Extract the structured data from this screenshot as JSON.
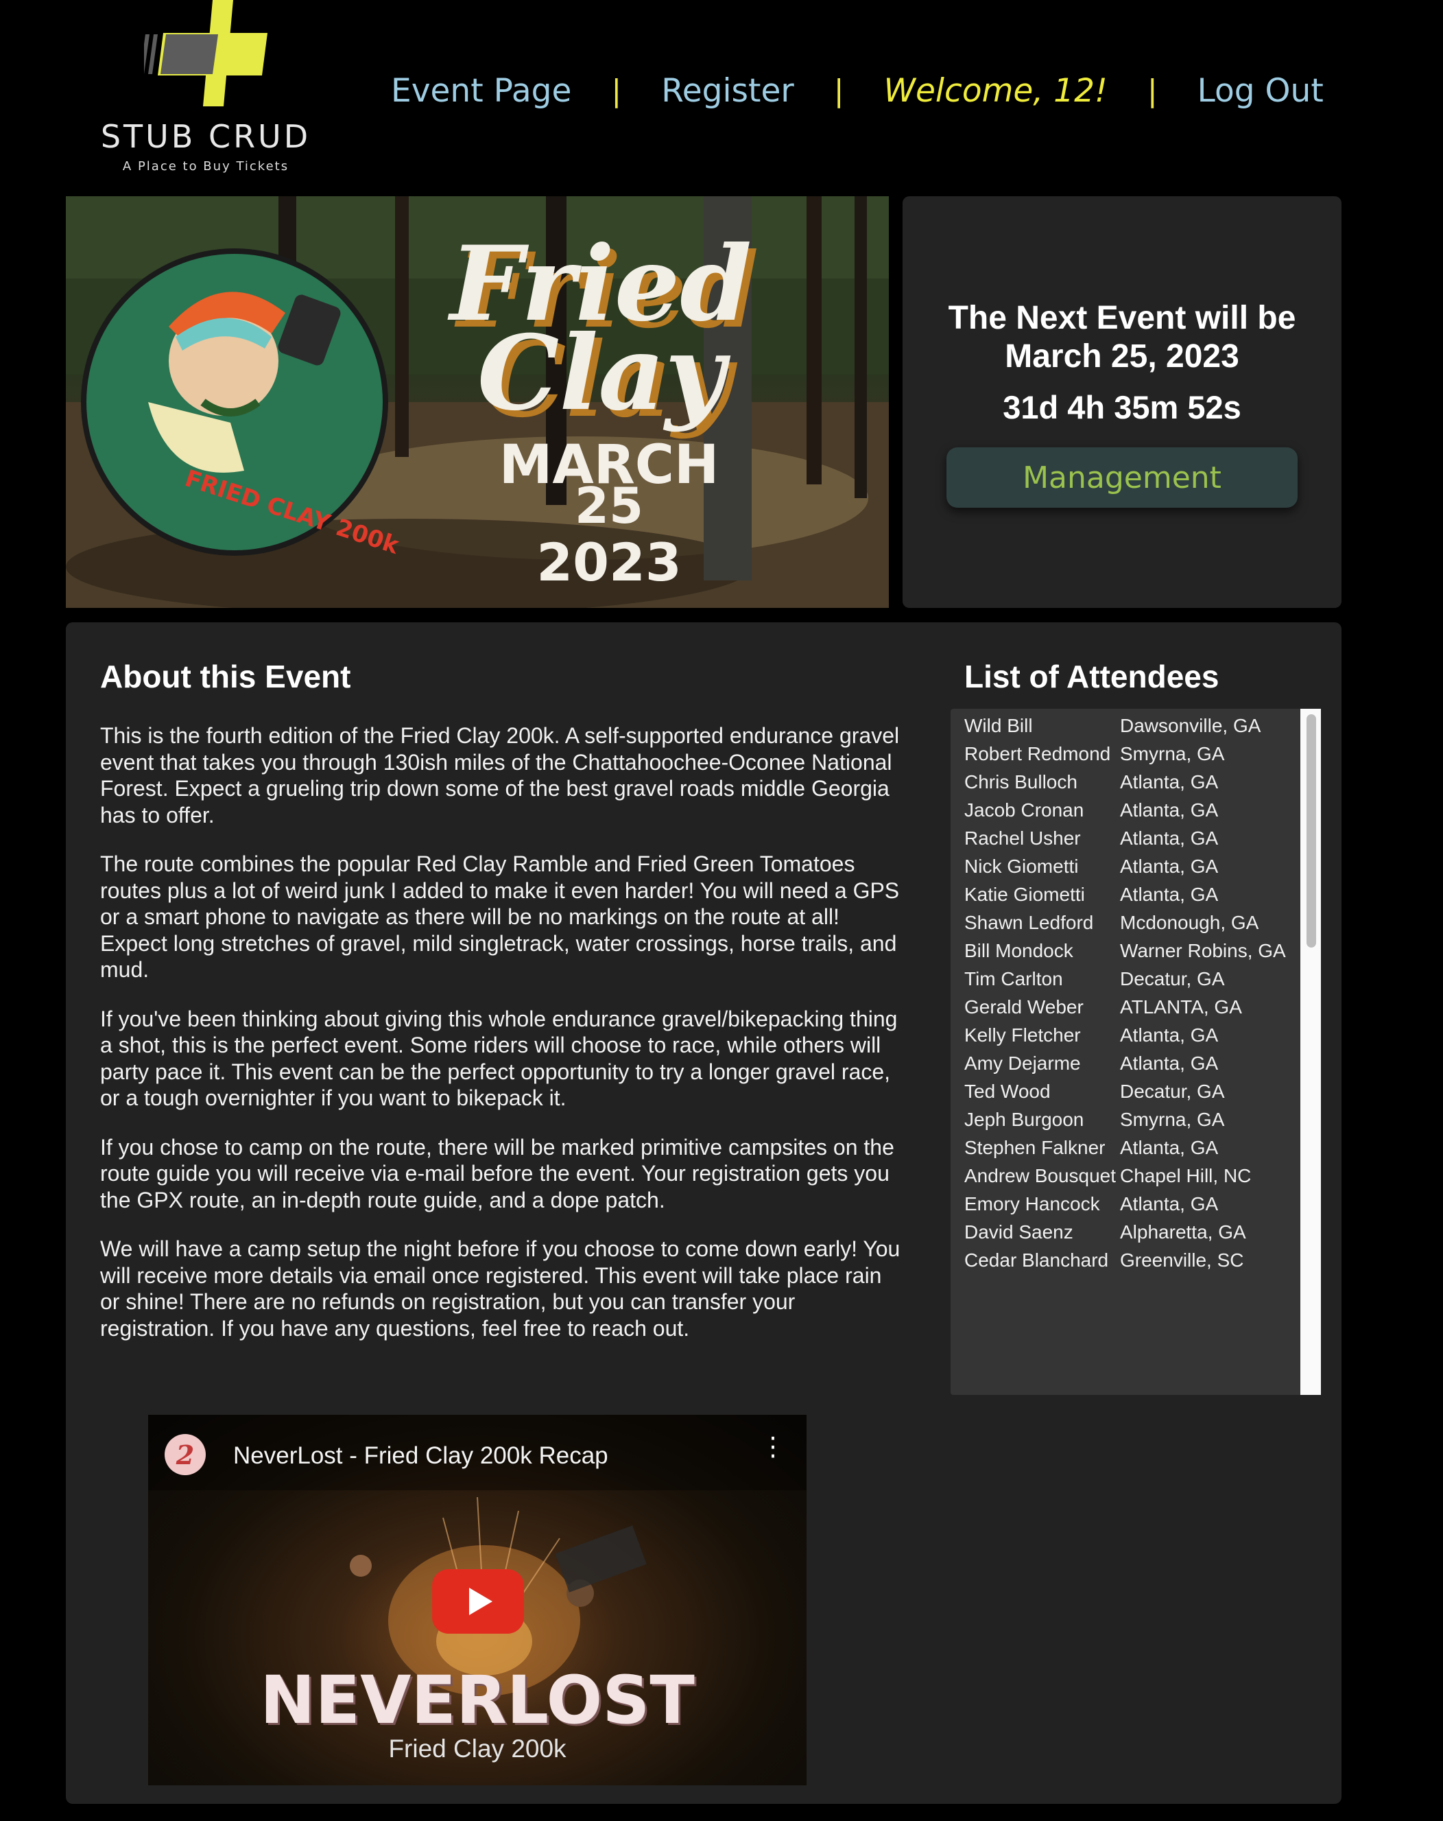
{
  "brand": {
    "name": "STUB CRUD",
    "tagline": "A Place to Buy Tickets",
    "colors": {
      "yellow": "#e6ea46",
      "gray": "#5c5c5c"
    }
  },
  "nav": {
    "event_page": "Event Page",
    "register": "Register",
    "welcome": "Welcome, 12!",
    "logout": "Log Out",
    "separator": "|"
  },
  "hero": {
    "title_line1": "Fried",
    "title_line2": "Clay",
    "date_month": "MARCH",
    "date_day": "25",
    "date_year": "2023",
    "badge_text": "FRIED CLAY 200k"
  },
  "next_event": {
    "line1": "The Next Event will be",
    "line2": "March 25, 2023",
    "countdown": "31d 4h 35m 52s",
    "management_label": "Management"
  },
  "about": {
    "title": "About this Event",
    "paragraphs": [
      "This is the fourth edition of the Fried Clay 200k. A self-supported endurance gravel event that takes you through 130ish miles of the Chattahoochee-Oconee National Forest. Expect a grueling trip down some of the best gravel roads middle Georgia has to offer.",
      "The route combines the popular Red Clay Ramble and Fried Green Tomatoes routes plus a lot of weird junk I added to make it even harder! You will need a GPS or a smart phone to navigate as there will be no markings on the route at all! Expect long stretches of gravel, mild singletrack, water crossings, horse trails, and mud.",
      "If you've been thinking about giving this whole endurance gravel/bikepacking thing a shot, this is the perfect event. Some riders will choose to race, while others will party pace it. This event can be the perfect opportunity to try a longer gravel race, or a tough overnighter if you want to bikepack it.",
      "If you chose to camp on the route, there will be marked primitive campsites on the route guide you will receive via e-mail before the event. Your registration gets you the GPX route, an in-depth route guide, and a dope patch.",
      "We will have a camp setup the night before if you choose to come down early! You will receive more details via email once registered. This event will take place rain or shine! There are no refunds on registration, but you can transfer your registration. If you have any questions, feel free to reach out."
    ]
  },
  "attendees": {
    "title": "List of Attendees",
    "rows": [
      {
        "name": "Wild Bill",
        "city": "Dawsonville, GA"
      },
      {
        "name": "Robert Redmond",
        "city": "Smyrna, GA"
      },
      {
        "name": "Chris Bulloch",
        "city": "Atlanta, GA"
      },
      {
        "name": "Jacob Cronan",
        "city": "Atlanta, GA"
      },
      {
        "name": "Rachel Usher",
        "city": "Atlanta, GA"
      },
      {
        "name": "Nick Giometti",
        "city": "Atlanta, GA"
      },
      {
        "name": "Katie Giometti",
        "city": "Atlanta, GA"
      },
      {
        "name": "Shawn Ledford",
        "city": "Mcdonough, GA"
      },
      {
        "name": "Bill Mondock",
        "city": "Warner Robins, GA"
      },
      {
        "name": "Tim Carlton",
        "city": "Decatur, GA"
      },
      {
        "name": "Gerald Weber",
        "city": "ATLANTA, GA"
      },
      {
        "name": "Kelly Fletcher",
        "city": "Atlanta, GA"
      },
      {
        "name": "Amy Dejarme",
        "city": "Atlanta, GA"
      },
      {
        "name": "Ted Wood",
        "city": "Decatur, GA"
      },
      {
        "name": "Jeph Burgoon",
        "city": "Smyrna, GA"
      },
      {
        "name": "Stephen Falkner",
        "city": "Atlanta, GA"
      },
      {
        "name": "Andrew Bousquet",
        "city": "Chapel Hill, NC"
      },
      {
        "name": "Emory Hancock",
        "city": "Atlanta, GA"
      },
      {
        "name": "David Saenz",
        "city": "Alpharetta, GA"
      },
      {
        "name": "Cedar Blanchard",
        "city": "Greenville, SC"
      }
    ]
  },
  "video": {
    "title": "NeverLost - Fried Clay 200k Recap",
    "logo_text": "NEVERLOST",
    "subtitle": "Fried Clay 200k",
    "channel_initial": "2"
  }
}
